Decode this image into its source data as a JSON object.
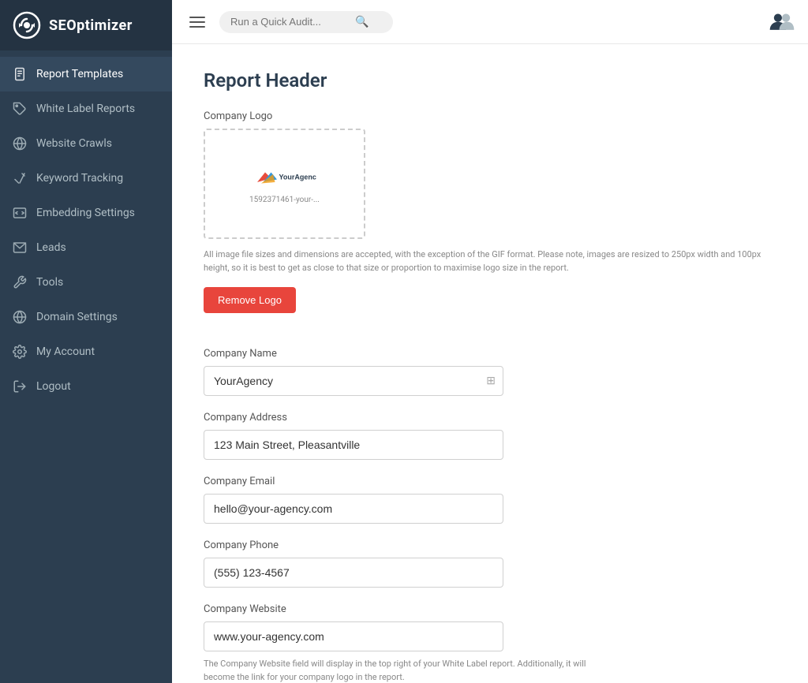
{
  "app": {
    "name": "SEOptimizer",
    "logo_alt": "SEOptimizer Logo"
  },
  "sidebar": {
    "items": [
      {
        "id": "report-templates",
        "label": "Report Templates",
        "active": true,
        "icon": "file-icon"
      },
      {
        "id": "white-label-reports",
        "label": "White Label Reports",
        "active": false,
        "icon": "tag-icon"
      },
      {
        "id": "website-crawls",
        "label": "Website Crawls",
        "active": false,
        "icon": "globe-icon"
      },
      {
        "id": "keyword-tracking",
        "label": "Keyword Tracking",
        "active": false,
        "icon": "pencil-icon"
      },
      {
        "id": "embedding-settings",
        "label": "Embedding Settings",
        "active": false,
        "icon": "embed-icon"
      },
      {
        "id": "leads",
        "label": "Leads",
        "active": false,
        "icon": "mail-icon"
      },
      {
        "id": "tools",
        "label": "Tools",
        "active": false,
        "icon": "wrench-icon"
      },
      {
        "id": "domain-settings",
        "label": "Domain Settings",
        "active": false,
        "icon": "globe2-icon"
      },
      {
        "id": "my-account",
        "label": "My Account",
        "active": false,
        "icon": "gear-icon"
      },
      {
        "id": "logout",
        "label": "Logout",
        "active": false,
        "icon": "logout-icon"
      }
    ]
  },
  "topbar": {
    "search_placeholder": "Run a Quick Audit..."
  },
  "main": {
    "page_title": "Report Header",
    "company_logo_label": "Company Logo",
    "logo_hint": "All image file sizes and dimensions are accepted, with the exception of the GIF format. Please note, images are resized to 250px width and 100px height, so it is best to get as close to that size or proportion to maximise logo size in the report.",
    "remove_logo_label": "Remove Logo",
    "company_name_label": "Company Name",
    "company_name_value": "YourAgency",
    "company_address_label": "Company Address",
    "company_address_value": "123 Main Street, Pleasantville",
    "company_email_label": "Company Email",
    "company_email_value": "hello@your-agency.com",
    "company_phone_label": "Company Phone",
    "company_phone_value": "(555) 123-4567",
    "company_website_label": "Company Website",
    "company_website_value": "www.your-agency.com",
    "company_website_hint": "The Company Website field will display in the top right of your White Label report. Additionally, it will become the link for your company logo in the report.",
    "logo_preview_name": "YourAgency",
    "logo_preview_filename": "1592371461-your-..."
  }
}
